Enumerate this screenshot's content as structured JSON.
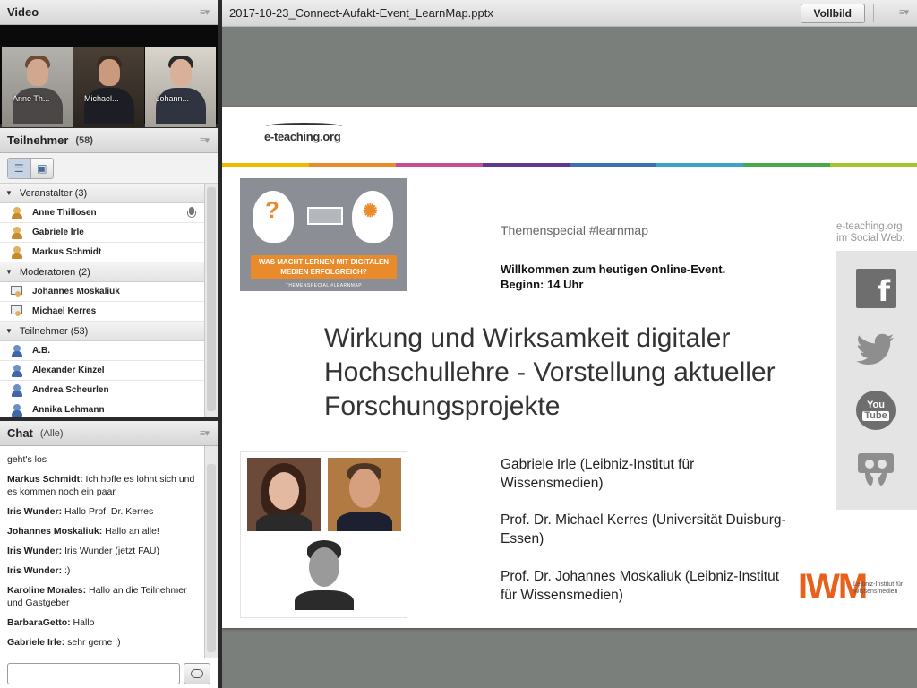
{
  "video": {
    "title": "Video",
    "tiles": [
      {
        "name": "Anne Th..."
      },
      {
        "name": "Michael..."
      },
      {
        "name": "Johann..."
      }
    ]
  },
  "participants": {
    "title": "Teilnehmer",
    "count": "(58)",
    "groups": [
      {
        "label": "Veranstalter (3)",
        "people": [
          "Anne Thillosen",
          "Gabriele Irle",
          "Markus Schmidt"
        ]
      },
      {
        "label": "Moderatoren (2)",
        "people": [
          "Johannes Moskaliuk",
          "Michael Kerres"
        ]
      },
      {
        "label": "Teilnehmer (53)",
        "people": [
          "A.B.",
          "Alexander Kinzel",
          "Andrea Scheurlen",
          "Annika Lehmann"
        ]
      }
    ]
  },
  "chat": {
    "title": "Chat",
    "scope": "(Alle)",
    "messages": [
      {
        "sender": "",
        "text": "geht's los"
      },
      {
        "sender": "Markus Schmidt",
        "text": "Ich hoffe es lohnt sich und es kommen noch ein paar"
      },
      {
        "sender": "Iris Wunder",
        "text": "Hallo Prof. Dr. Kerres"
      },
      {
        "sender": "Johannes Moskaliuk",
        "text": "Hallo an alle!"
      },
      {
        "sender": "Iris Wunder",
        "text": "Iris Wunder (jetzt FAU)"
      },
      {
        "sender": "Iris Wunder",
        "text": ":)"
      },
      {
        "sender": "Karoline Morales",
        "text": "Hallo an die Teilnehmer und Gastgeber"
      },
      {
        "sender": "BarbaraGetto",
        "text": "Hallo"
      },
      {
        "sender": "Gabriele Irle",
        "text": "sehr gerne :)"
      }
    ]
  },
  "share": {
    "file_name": "2017-10-23_Connect-Aufakt-Event_LearnMap.pptx",
    "fullscreen_label": "Vollbild"
  },
  "slide": {
    "logo_text": "e-teaching.org",
    "stripe_colors": [
      "#f2b800",
      "#e98b2a",
      "#c64d91",
      "#5b3a8e",
      "#3c6fb6",
      "#3ca3c9",
      "#47a94b",
      "#a3c42a"
    ],
    "promo_banner": "WAS MACHT LERNEN MIT DIGITALEN MEDIEN ERFOLGREICH?",
    "promo_footer": "THEMENSPECIAL #LEARNMAP",
    "themenspecial": "Themenspecial #learnmap",
    "welcome_line1": "Willkommen zum heutigen Online-Event.",
    "welcome_line2": "Beginn: 14 Uhr",
    "title": "Wirkung und Wirksamkeit digitaler Hochschullehre - Vorstellung aktueller Forschungsprojekte",
    "speakers": [
      "Gabriele Irle (Leibniz-Institut für Wissensmedien)",
      "Prof. Dr. Michael Kerres (Universität Duisburg-Essen)",
      "Prof. Dr. Johannes Moskaliuk (Leibniz-Institut für Wissensmedien)"
    ],
    "social_label_1": "e-teaching.org",
    "social_label_2": "im Social Web:",
    "social": [
      "facebook-icon",
      "twitter-icon",
      "youtube-icon",
      "slideshare-icon"
    ],
    "youtube_text_1": "You",
    "youtube_text_2": "Tube",
    "iwm_logo": "IWM",
    "iwm_sub_1": "Leibniz-Institut für",
    "iwm_sub_2": "Wissensmedien"
  }
}
